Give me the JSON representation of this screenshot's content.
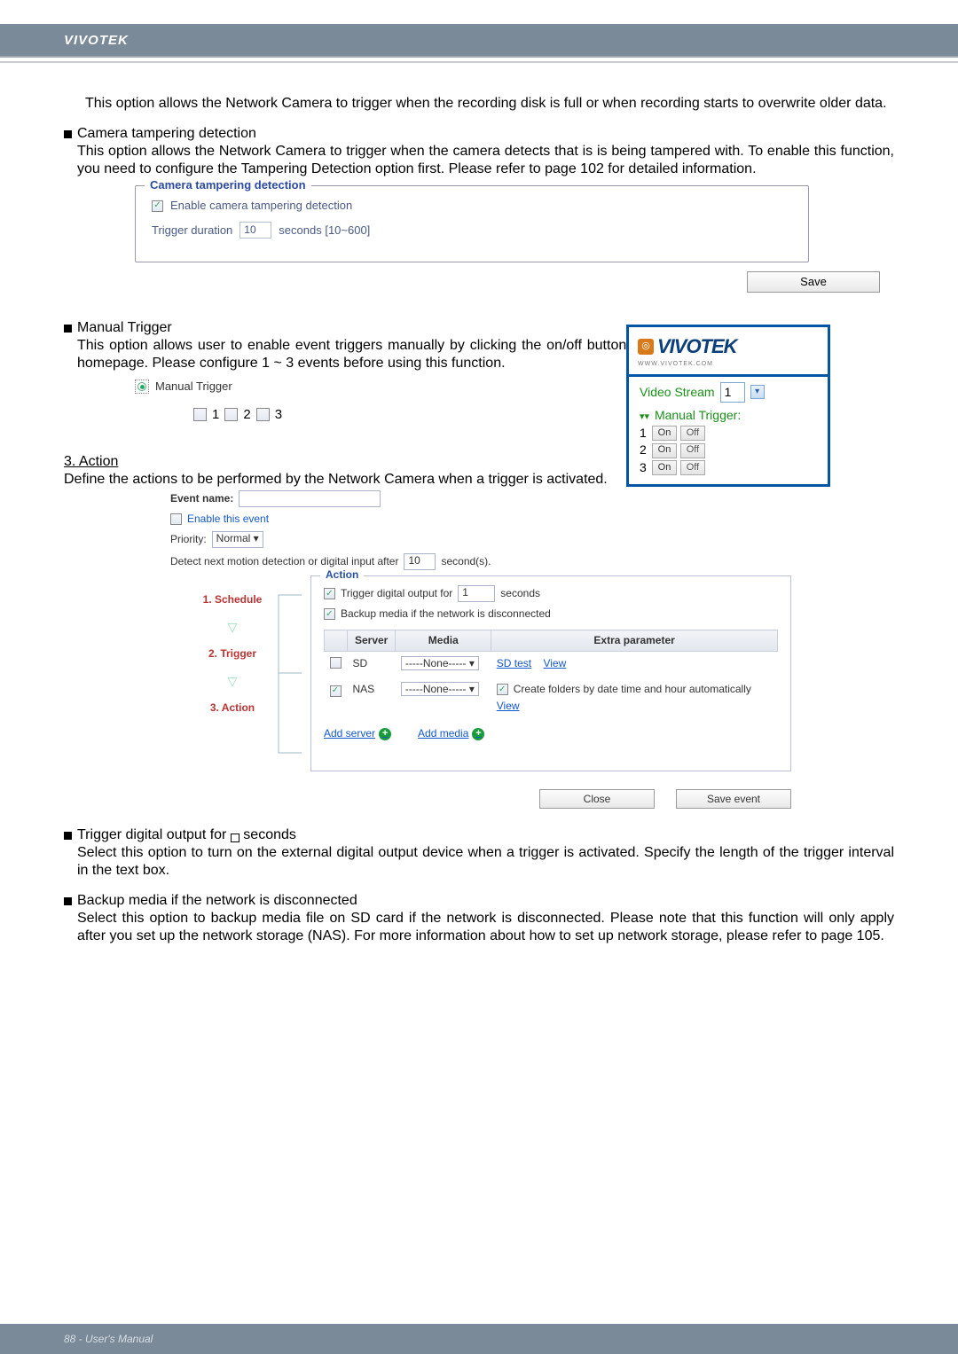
{
  "header": {
    "brand": "VIVOTEK"
  },
  "intro_para": "This option allows the Network Camera to trigger when the recording disk is full or when recording starts to overwrite older data.",
  "tampering": {
    "bullet_title": "Camera tampering detection",
    "bullet_body": "This option allows the Network Camera to trigger when the camera detects that is is being tampered with. To enable this function, you need to configure the Tampering Detection option first. Please refer to page 102 for detailed information.",
    "fieldset_legend": "Camera tampering detection",
    "enable_label": "Enable camera tampering detection",
    "trigger_duration_label": "Trigger duration",
    "trigger_duration_value": "10",
    "trigger_duration_suffix": "seconds [10~600]",
    "save_button": "Save"
  },
  "manual_trigger": {
    "bullet_title": "Manual Trigger",
    "bullet_body": "This option allows user to enable event triggers manually by clicking the on/off button on the homepage. Please configure 1 ~ 3 events before using this function.",
    "radio_label": "Manual Trigger",
    "nums": [
      "1",
      "2",
      "3"
    ]
  },
  "viv_panel": {
    "logo_text": "VIVOTEK",
    "logo_sub": "WWW.VIVOTEK.COM",
    "video_stream_label": "Video Stream",
    "video_stream_value": "1",
    "mt_label": "Manual Trigger:",
    "rows": [
      {
        "num": "1",
        "on": "On",
        "off": "Off"
      },
      {
        "num": "2",
        "on": "On",
        "off": "Off"
      },
      {
        "num": "3",
        "on": "On",
        "off": "Off"
      }
    ]
  },
  "action": {
    "heading": "3. Action",
    "body": "Define the actions to be performed by the Network Camera when a trigger is activated.",
    "event_name_label": "Event name:",
    "event_name_value": "",
    "enable_event_label": "Enable this event",
    "priority_label": "Priority:",
    "priority_value": "Normal",
    "detect_label_prefix": "Detect next motion detection or digital input after",
    "detect_value": "10",
    "detect_suffix": "second(s).",
    "legend": "Action",
    "trigger_do_label": "Trigger digital output for",
    "trigger_do_value": "1",
    "trigger_do_suffix": "seconds",
    "backup_label": "Backup media if the network is disconnected",
    "table": {
      "headers": [
        "",
        "Server",
        "Media",
        "Extra parameter"
      ],
      "rows": [
        {
          "server": "SD",
          "media": "-----None-----",
          "extra_link1": "SD test",
          "extra_link2": "View"
        },
        {
          "server": "NAS",
          "media": "-----None-----",
          "extra_check": "Create folders by date time and hour automatically",
          "extra_link": "View"
        }
      ]
    },
    "add_server": "Add server",
    "add_media": "Add media",
    "steps": [
      "1.  Schedule",
      "2.  Trigger",
      "3.  Action"
    ],
    "close_btn": "Close",
    "save_event_btn": "Save event"
  },
  "notes": {
    "n1_title": "Trigger digital output for",
    "n1_title2": "seconds",
    "n1_body": "Select this option to turn on the external digital output device when a trigger is activated. Specify the length of the trigger interval in the text box.",
    "n2_title": "Backup media if the network is disconnected",
    "n2_body": "Select this option to backup media file on SD card if the network is disconnected. Please note that this function will only apply after you set up the network storage (NAS). For more information about how to set up network storage, please refer to page 105."
  },
  "footer": {
    "text": "88 - User's Manual"
  }
}
